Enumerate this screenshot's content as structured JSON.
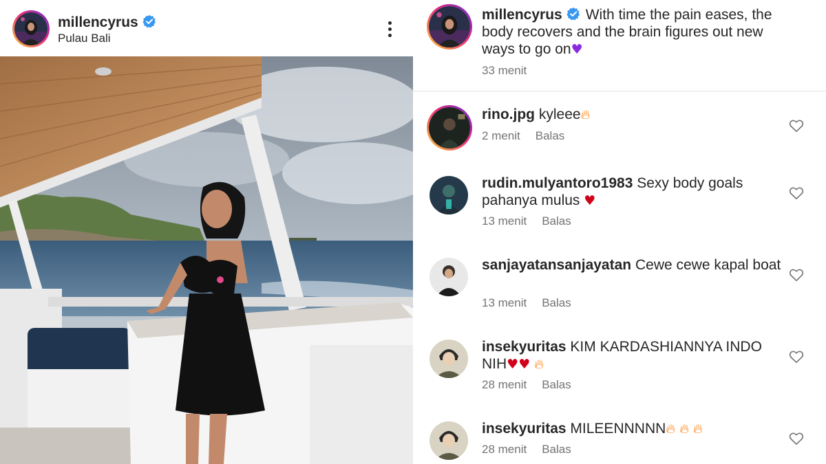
{
  "post": {
    "username": "millencyrus",
    "location": "Pulau Bali",
    "caption": "With time the pain eases, the body recovers and the brain figures out new ways to go on",
    "caption_emoji": "purple-heart",
    "time": "33 menit"
  },
  "reply_label": "Balas",
  "comments": [
    {
      "username": "rino.jpg",
      "text": "kyleee",
      "emojis": [
        "fire"
      ],
      "time": "2 menit"
    },
    {
      "username": "rudin.mulyantoro1983",
      "text": "Sexy body goals pahanya mulus",
      "emojis": [
        "red-heart"
      ],
      "time": "13 menit"
    },
    {
      "username": "sanjayatansanjayatan",
      "text": "Cewe cewe kapal boat",
      "emojis": [],
      "time": "13 menit"
    },
    {
      "username": "insekyuritas",
      "text": "KIM KARDASHIANNYA INDO NIH",
      "emojis": [
        "red-heart",
        "red-heart",
        "fire"
      ],
      "time": "28 menit"
    },
    {
      "username": "insekyuritas",
      "text": "MILEENNNNN",
      "emojis": [
        "fire",
        "fire",
        "fire"
      ],
      "time": "28 menit"
    }
  ],
  "colors": {
    "verified": "#3897f0",
    "story_ring": "#ee2a7b",
    "meta_text": "#737373",
    "heart": "#d0021b",
    "fire": "#ff7a00"
  }
}
